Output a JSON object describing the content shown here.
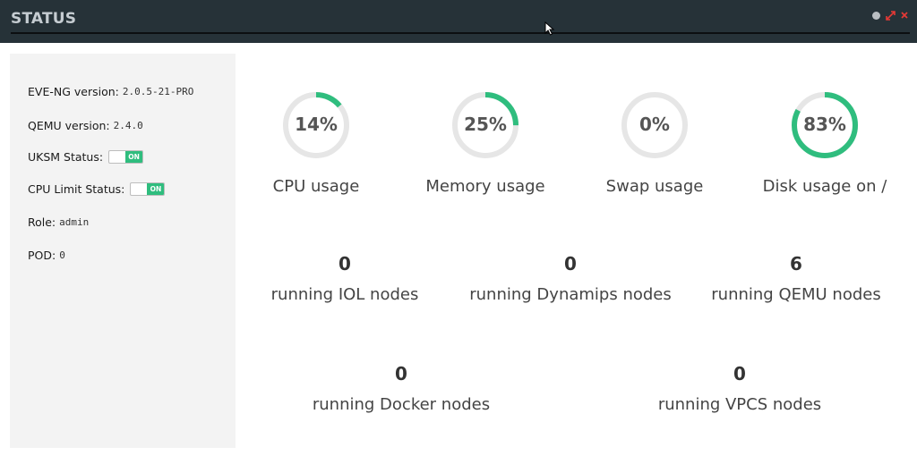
{
  "window": {
    "title": "STATUS",
    "buttons": [
      "restore-icon",
      "maximize-icon",
      "close-icon"
    ],
    "accent": "#263238"
  },
  "sidebar": {
    "eve_version_label": "EVE-NG version:",
    "eve_version_value": "2.0.5-21-PRO",
    "qemu_version_label": "QEMU version:",
    "qemu_version_value": "2.4.0",
    "uksm_label": "UKSM Status:",
    "uksm_toggle": "ON",
    "cpu_limit_label": "CPU Limit Status:",
    "cpu_limit_toggle": "ON",
    "role_label": "Role:",
    "role_value": "admin",
    "pod_label": "POD:",
    "pod_value": "0"
  },
  "gauges": [
    {
      "label": "CPU usage",
      "percent": 14,
      "text": "14%"
    },
    {
      "label": "Memory usage",
      "percent": 25,
      "text": "25%"
    },
    {
      "label": "Swap usage",
      "percent": 0,
      "text": "0%"
    },
    {
      "label": "Disk usage on /",
      "percent": 83,
      "text": "83%"
    }
  ],
  "gauge_color": "#2fbd7e",
  "gauge_track_color": "#e6e6e6",
  "counters": [
    {
      "label": "running IOL nodes",
      "value": "0"
    },
    {
      "label": "running Dynamips nodes",
      "value": "0"
    },
    {
      "label": "running QEMU nodes",
      "value": "6"
    },
    {
      "label": "running Docker nodes",
      "value": "0"
    },
    {
      "label": "running VPCS nodes",
      "value": "0"
    }
  ]
}
